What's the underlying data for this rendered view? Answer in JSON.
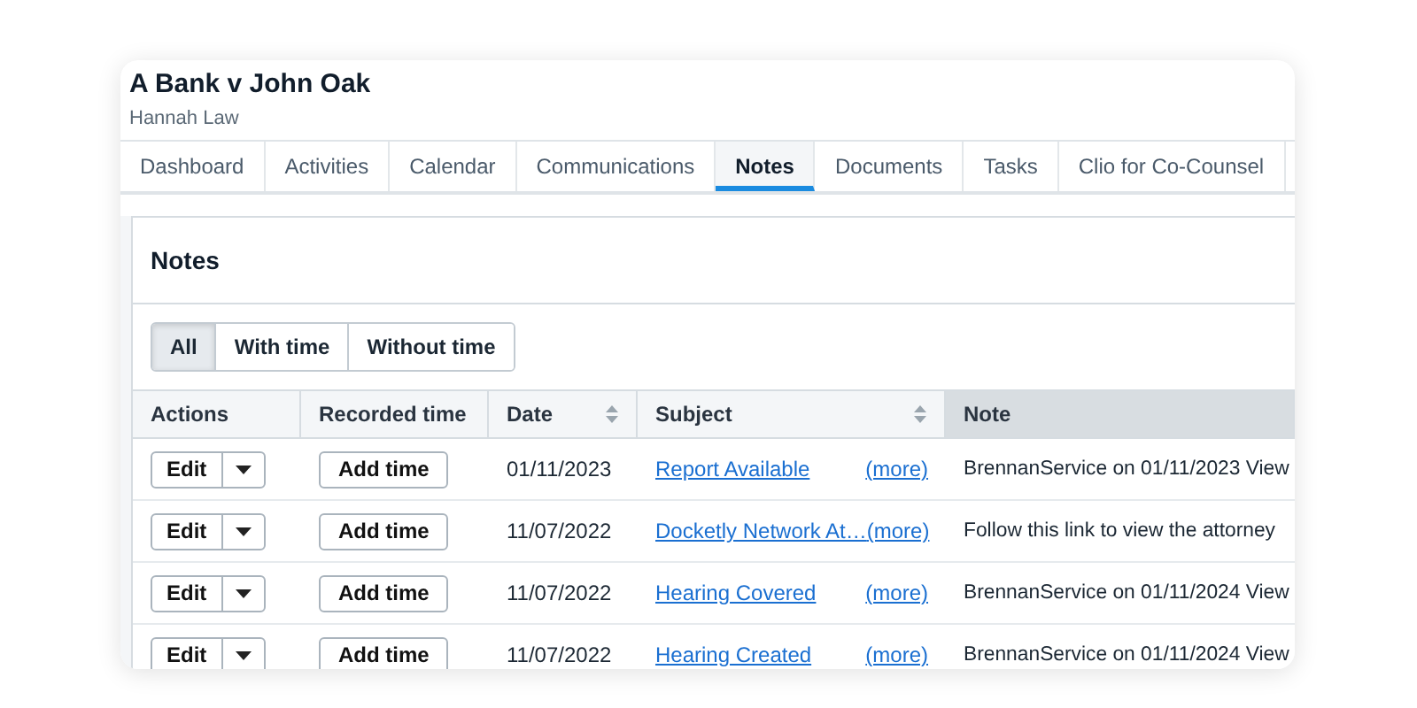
{
  "matter": {
    "title": "A Bank v John Oak",
    "subtitle": "Hannah Law"
  },
  "tabs": [
    {
      "label": "Dashboard",
      "selected": false
    },
    {
      "label": "Activities",
      "selected": false
    },
    {
      "label": "Calendar",
      "selected": false
    },
    {
      "label": "Communications",
      "selected": false
    },
    {
      "label": "Notes",
      "selected": true
    },
    {
      "label": "Documents",
      "selected": false
    },
    {
      "label": "Tasks",
      "selected": false
    },
    {
      "label": "Clio for Co-Counsel",
      "selected": false
    }
  ],
  "panel": {
    "title": "Notes",
    "filters": [
      {
        "label": "All",
        "selected": true
      },
      {
        "label": "With time",
        "selected": false
      },
      {
        "label": "Without time",
        "selected": false
      }
    ],
    "table": {
      "columns": [
        {
          "label": "Actions",
          "sortable": false,
          "highlighted": false
        },
        {
          "label": "Recorded time",
          "sortable": false,
          "highlighted": false
        },
        {
          "label": "Date",
          "sortable": true,
          "highlighted": false
        },
        {
          "label": "Subject",
          "sortable": true,
          "highlighted": false
        },
        {
          "label": "Note",
          "sortable": false,
          "highlighted": true
        }
      ],
      "rows": [
        {
          "edit": "Edit",
          "add_time": "Add time",
          "date": "01/11/2023",
          "subject": "Report Available",
          "more": "(more)",
          "note": "BrennanService on 01/11/2023 View"
        },
        {
          "edit": "Edit",
          "add_time": "Add time",
          "date": "11/07/2022",
          "subject": "Docketly Network At…",
          "more": "(more)",
          "note": "Follow this link to view the attorney"
        },
        {
          "edit": "Edit",
          "add_time": "Add time",
          "date": "11/07/2022",
          "subject": "Hearing Covered",
          "more": "(more)",
          "note": "BrennanService on 01/11/2024 View"
        },
        {
          "edit": "Edit",
          "add_time": "Add time",
          "date": "11/07/2022",
          "subject": "Hearing Created",
          "more": "(more)",
          "note": "BrennanService on 01/11/2024 View"
        }
      ]
    }
  }
}
